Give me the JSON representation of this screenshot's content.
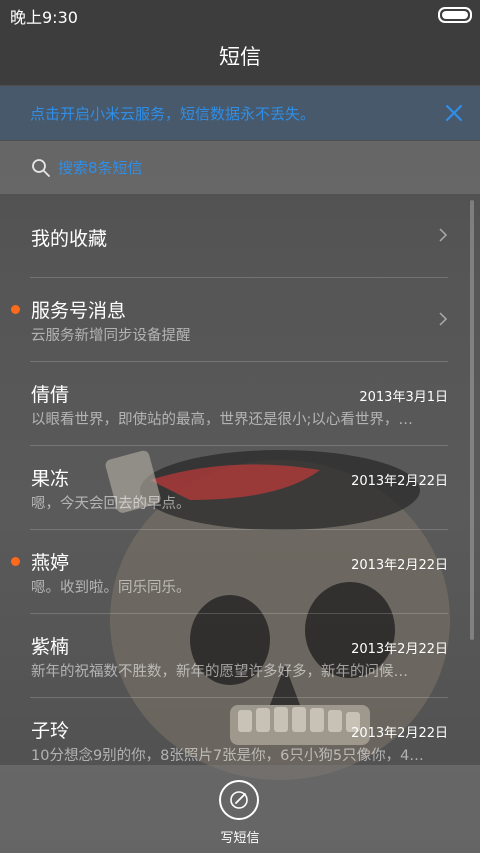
{
  "status": {
    "time": "晚上9:30"
  },
  "header": {
    "title": "短信"
  },
  "banner": {
    "text": "点击开启小米云服务，短信数据永不丢失。"
  },
  "search": {
    "placeholder": "搜索8条短信"
  },
  "list": {
    "items": [
      {
        "name": "我的收藏",
        "preview": "",
        "date": "",
        "unread": false,
        "chevron": true
      },
      {
        "name": "服务号消息",
        "preview": "云服务新增同步设备提醒",
        "date": "",
        "unread": true,
        "chevron": true
      },
      {
        "name": "倩倩",
        "preview": "以眼看世界，即使站的最高，世界还是很小;以心看世界，…",
        "date": "2013年3月1日",
        "unread": false,
        "chevron": false
      },
      {
        "name": "果冻",
        "preview": "嗯，今天会回去的早点。",
        "date": "2013年2月22日",
        "unread": false,
        "chevron": false
      },
      {
        "name": "燕婷",
        "preview": "嗯。收到啦。同乐同乐。",
        "date": "2013年2月22日",
        "unread": true,
        "chevron": false
      },
      {
        "name": "紫楠",
        "preview": "新年的祝福数不胜数，新年的愿望许多好多，新年的问候…",
        "date": "2013年2月22日",
        "unread": false,
        "chevron": false
      },
      {
        "name": "子玲",
        "preview": "10分想念9别的你，8张照片7张是你，6只小狗5只像你，4…",
        "date": "2013年2月22日",
        "unread": false,
        "chevron": false
      }
    ]
  },
  "compose": {
    "label": "写短信"
  },
  "colors": {
    "accent": "#2f8ee8",
    "unread_dot": "#ff6a1a"
  }
}
